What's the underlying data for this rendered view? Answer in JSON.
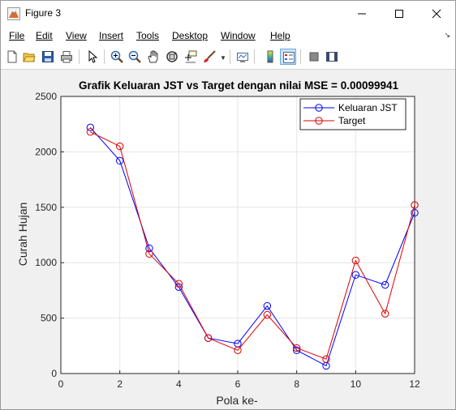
{
  "window": {
    "title": "Figure 3"
  },
  "menu": [
    "File",
    "Edit",
    "View",
    "Insert",
    "Tools",
    "Desktop",
    "Window",
    "Help"
  ],
  "toolbar_icons": [
    "new-figure-icon",
    "open-folder-icon",
    "save-icon",
    "print-icon",
    "pointer-icon",
    "zoom-in-icon",
    "zoom-out-icon",
    "pan-icon",
    "rotate-3d-icon",
    "data-cursor-icon",
    "brush-icon",
    "brush-dropdown-icon",
    "link-plot-icon",
    "colorbar-icon",
    "legend-icon",
    "hide-plot-tools-icon",
    "show-plot-tools-icon"
  ],
  "colors": {
    "series1": "#0000ff",
    "series2": "#dd0000",
    "grid": "#e6e6e6"
  },
  "chart_data": {
    "type": "line",
    "title": "Grafik Keluaran JST vs Target dengan nilai MSE = 0.00099941",
    "xlabel": "Pola ke-",
    "ylabel": "Curah Hujan",
    "xlim": [
      0,
      12
    ],
    "ylim": [
      0,
      2500
    ],
    "xticks": [
      0,
      2,
      4,
      6,
      8,
      10,
      12
    ],
    "yticks": [
      0,
      500,
      1000,
      1500,
      2000,
      2500
    ],
    "grid": true,
    "legend_position": "top-right",
    "x": [
      1,
      2,
      3,
      4,
      5,
      6,
      7,
      8,
      9,
      10,
      11,
      12
    ],
    "series": [
      {
        "name": "Keluaran JST",
        "color": "#0000ff",
        "values": [
          2220,
          1920,
          1130,
          780,
          320,
          270,
          610,
          210,
          70,
          890,
          800,
          1450
        ]
      },
      {
        "name": "Target",
        "color": "#dd0000",
        "values": [
          2180,
          2050,
          1080,
          810,
          320,
          210,
          530,
          230,
          130,
          1020,
          540,
          1520
        ]
      }
    ]
  }
}
